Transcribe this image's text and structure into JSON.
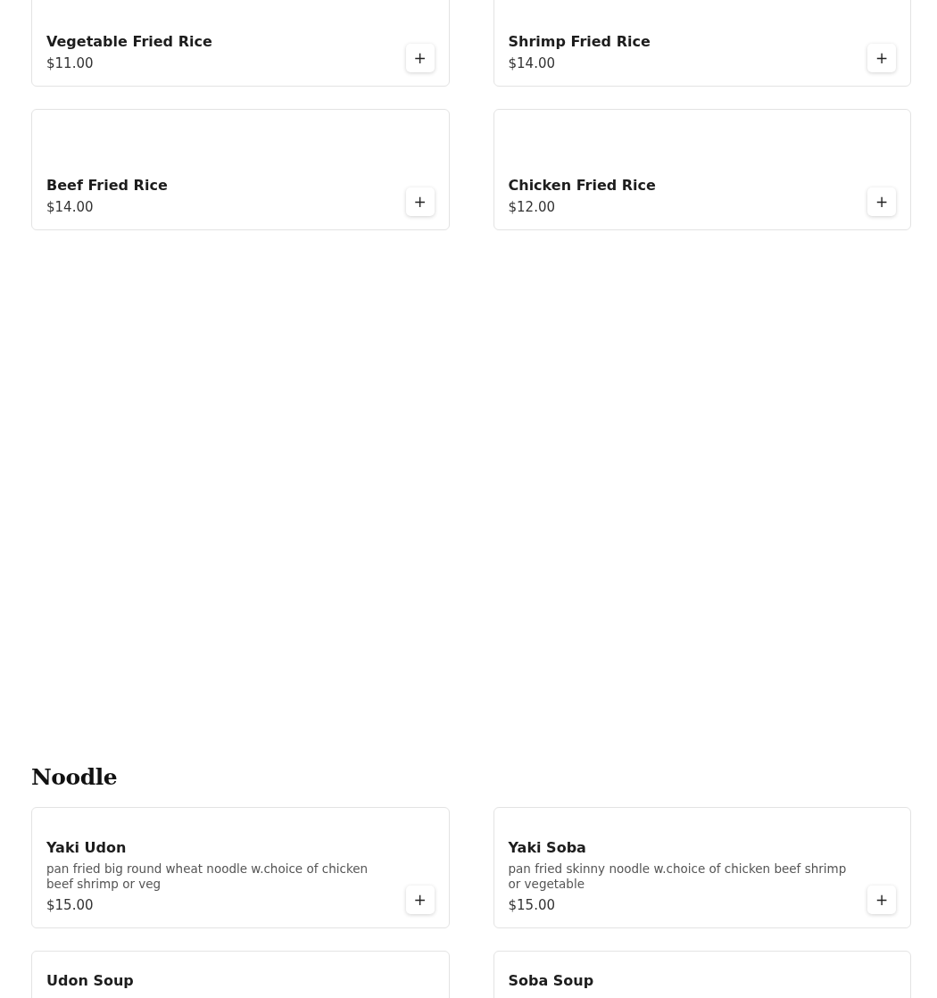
{
  "sections": [
    {
      "items": [
        {
          "name": "Vegetable Fried Rice",
          "price": "$11.00",
          "add_label": "+"
        },
        {
          "name": "Shrimp Fried Rice",
          "price": "$14.00",
          "add_label": "+"
        },
        {
          "name": "Beef Fried Rice",
          "price": "$14.00",
          "add_label": "+"
        },
        {
          "name": "Chicken Fried Rice",
          "price": "$12.00",
          "add_label": "+"
        }
      ]
    },
    {
      "title": "Noodle",
      "items": [
        {
          "name": "Yaki Udon",
          "description": "pan fried big round wheat noodle w.choice of chicken beef shrimp or veg",
          "price": "$15.00",
          "add_label": "+"
        },
        {
          "name": "Yaki Soba",
          "description": "pan fried skinny noodle w.choice of chicken beef shrimp or vegetable",
          "price": "$15.00",
          "add_label": "+"
        },
        {
          "name": "Udon Soup"
        },
        {
          "name": "Soba Soup"
        }
      ]
    }
  ]
}
